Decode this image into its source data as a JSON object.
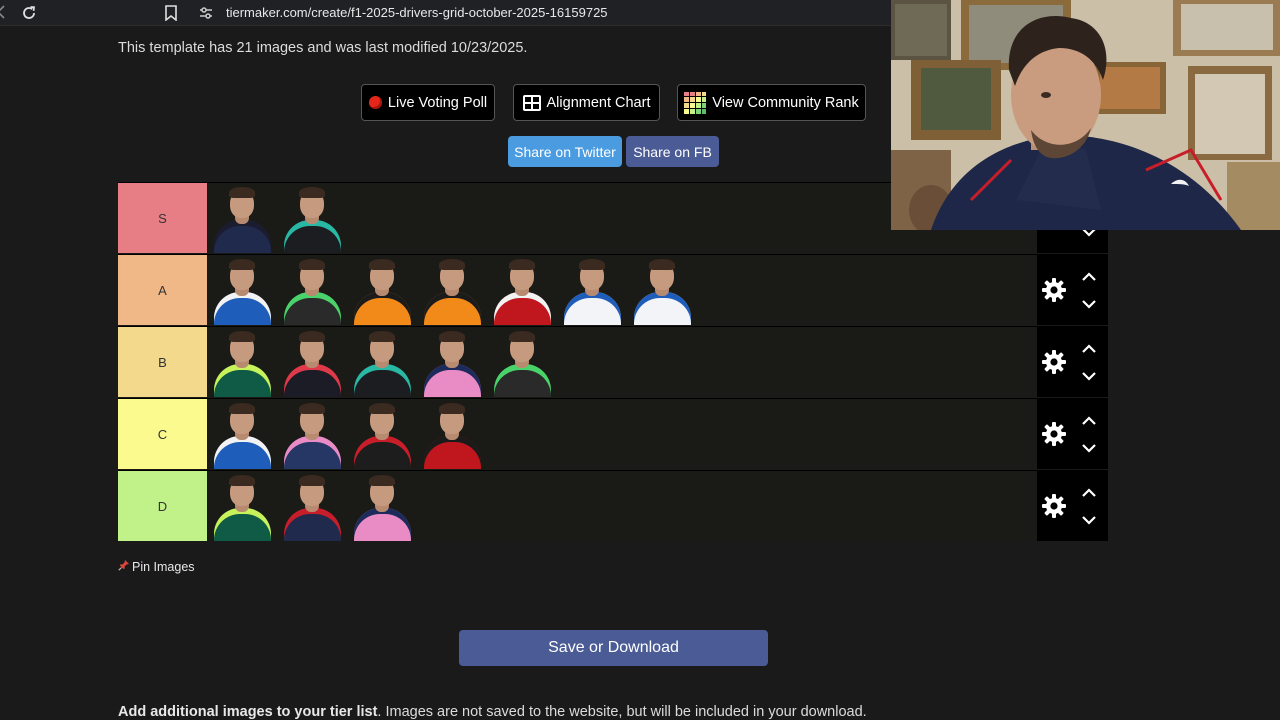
{
  "browser": {
    "url": "tiermaker.com/create/f1-2025-drivers-grid-october-2025-16159725"
  },
  "template_info": "This template has 21 images and was last modified 10/23/2025.",
  "actions": {
    "live_voting_poll": "Live Voting Poll",
    "alignment_chart": "Alignment Chart",
    "view_community_rank": "View Community Rank",
    "share_twitter": "Share on Twitter",
    "share_fb": "Share on FB"
  },
  "colors": {
    "twitter_button": "#4a9be0",
    "fb_button": "#4a5b95",
    "save_button": "#4a5b95",
    "tier_S": "#e87e85",
    "tier_A": "#f0b887",
    "tier_B": "#f3d98c",
    "tier_C": "#fafa8f",
    "tier_D": "#c1f28a"
  },
  "tiers": [
    {
      "label": "S",
      "color": "#e87e85",
      "items": [
        {
          "team": "red-bull",
          "suit": "#1f2a4d",
          "accent": "#1c1c30"
        },
        {
          "team": "mercedes",
          "suit": "#1b1d20",
          "accent": "#29b8a4"
        }
      ]
    },
    {
      "label": "A",
      "color": "#f0b887",
      "items": [
        {
          "team": "williams",
          "suit": "#1f5dbb",
          "accent": "#f2f2f2"
        },
        {
          "team": "sauber",
          "suit": "#2a2a2a",
          "accent": "#4ad36a"
        },
        {
          "team": "mclaren",
          "suit": "#f28a1a",
          "accent": "#1b1b1b"
        },
        {
          "team": "mclaren",
          "suit": "#f28a1a",
          "accent": "#1b1b1b"
        },
        {
          "team": "ferrari",
          "suit": "#c0161d",
          "accent": "#f2f2f2"
        },
        {
          "team": "williams",
          "suit": "#f2f4f8",
          "accent": "#1f5dbb"
        },
        {
          "team": "williams",
          "suit": "#f2f4f8",
          "accent": "#1f5dbb"
        }
      ]
    },
    {
      "label": "B",
      "color": "#f3d98c",
      "items": [
        {
          "team": "aston-martin",
          "suit": "#0f5b45",
          "accent": "#c8f25a"
        },
        {
          "team": "racing-bulls",
          "suit": "#1c1c26",
          "accent": "#e03a4a"
        },
        {
          "team": "mercedes",
          "suit": "#1b1d20",
          "accent": "#29b8a4"
        },
        {
          "team": "alpine",
          "suit": "#e98cc6",
          "accent": "#1c2b5c"
        },
        {
          "team": "sauber",
          "suit": "#2a2a2a",
          "accent": "#4ad36a"
        }
      ]
    },
    {
      "label": "C",
      "color": "#fafa8f",
      "items": [
        {
          "team": "williams",
          "suit": "#1f5dbb",
          "accent": "#f2f2f2"
        },
        {
          "team": "alpine",
          "suit": "#263766",
          "accent": "#e98cc6"
        },
        {
          "team": "haas",
          "suit": "#1d1d1d",
          "accent": "#c81e2a"
        },
        {
          "team": "ferrari",
          "suit": "#c0161d",
          "accent": "#1b1b1b"
        }
      ]
    },
    {
      "label": "D",
      "color": "#c1f28a",
      "items": [
        {
          "team": "aston-martin",
          "suit": "#0f5b45",
          "accent": "#c8f25a"
        },
        {
          "team": "red-bull",
          "suit": "#1f2a4d",
          "accent": "#c81e2a"
        },
        {
          "team": "alpine",
          "suit": "#e98cc6",
          "accent": "#1c2b5c"
        }
      ]
    }
  ],
  "pin_images": "Pin Images",
  "save_download": "Save or Download",
  "add_images": {
    "bold": "Add additional images to your tier list",
    "rest": ". Images are not saved to the website, but will be included in your download."
  }
}
